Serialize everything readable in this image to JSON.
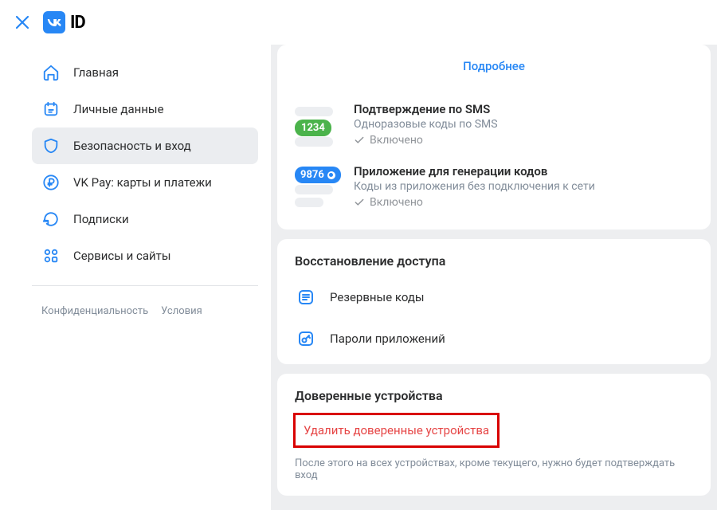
{
  "brand": {
    "id_label": "ID"
  },
  "sidebar": {
    "items": [
      {
        "label": "Главная"
      },
      {
        "label": "Личные данные"
      },
      {
        "label": "Безопасность и вход"
      },
      {
        "label": "VK Pay: карты и платежи"
      },
      {
        "label": "Подписки"
      },
      {
        "label": "Сервисы и сайты"
      }
    ],
    "footer": {
      "privacy": "Конфиденциальность",
      "terms": "Условия"
    }
  },
  "main": {
    "more_link": "Подробнее",
    "methods": [
      {
        "badge": "1234",
        "title": "Подтверждение по SMS",
        "subtitle": "Одноразовые коды по SMS",
        "status": "Включено"
      },
      {
        "badge": "9876",
        "title": "Приложение для генерации кодов",
        "subtitle": "Коды из приложения без подключения к сети",
        "status": "Включено"
      }
    ],
    "recovery": {
      "title": "Восстановление доступа",
      "items": [
        {
          "label": "Резервные коды"
        },
        {
          "label": "Пароли приложений"
        }
      ]
    },
    "trusted": {
      "title": "Доверенные устройства",
      "delete_label": "Удалить доверенные устройства",
      "hint": "После этого на всех устройствах, кроме текущего, нужно будет подтверждать вход"
    }
  },
  "colors": {
    "accent": "#2787f5",
    "danger": "#e64646",
    "success": "#4bb34b"
  }
}
